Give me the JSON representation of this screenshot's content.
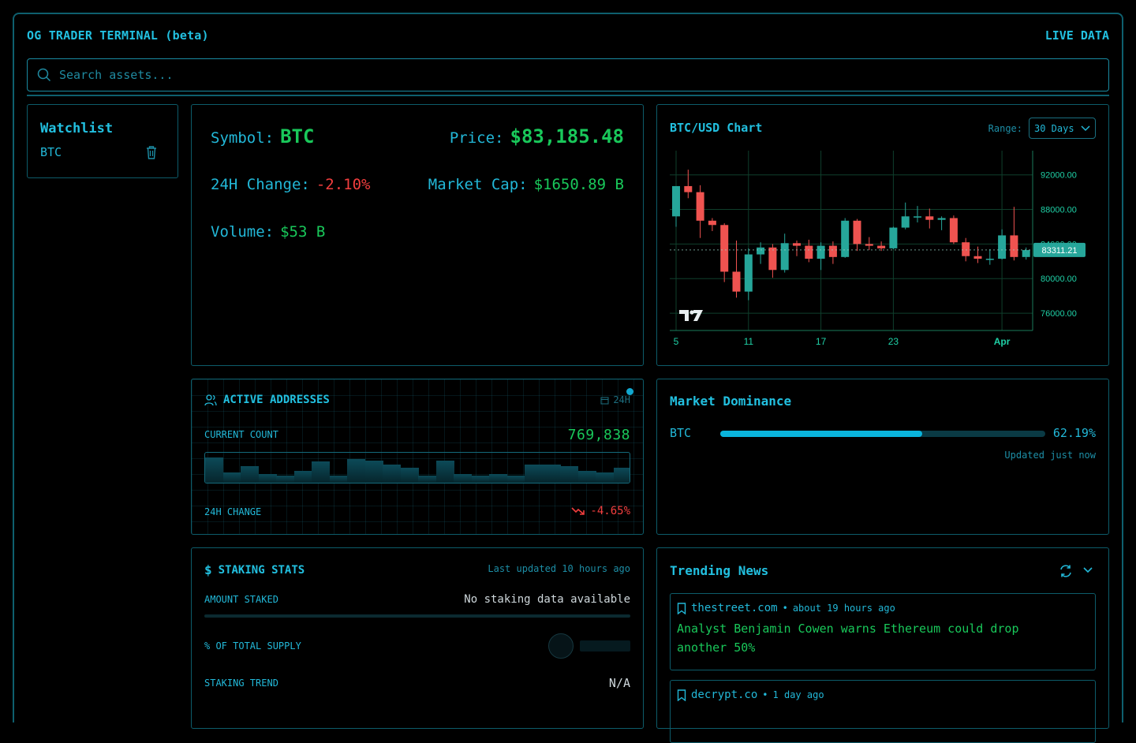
{
  "app": {
    "title": "OG TRADER TERMINAL (beta)",
    "status": "LIVE DATA"
  },
  "search": {
    "placeholder": "Search assets..."
  },
  "watchlist": {
    "title": "Watchlist",
    "items": [
      {
        "symbol": "BTC"
      }
    ]
  },
  "info": {
    "symbol_label": "Symbol:",
    "symbol": "BTC",
    "price_label": "Price:",
    "price": "$83,185.48",
    "change_label": "24H Change:",
    "change": "-2.10%",
    "mcap_label": "Market Cap:",
    "mcap": "$1650.89 B",
    "volume_label": "Volume:",
    "volume": "$53 B"
  },
  "chart": {
    "title": "BTC/USD Chart",
    "range_label": "Range:",
    "range_value": "30 Days",
    "last_price_label": "83311.21"
  },
  "chart_data": {
    "type": "candlestick",
    "title": "BTC/USD Chart",
    "xlabel": "",
    "ylabel": "",
    "ylim": [
      74000,
      94800
    ],
    "y_ticks": [
      "92000.00",
      "88000.00",
      "84000.00",
      "80000.00",
      "76000.00"
    ],
    "x_ticks": [
      {
        "label": "5",
        "index": 0
      },
      {
        "label": "11",
        "index": 6
      },
      {
        "label": "17",
        "index": 12
      },
      {
        "label": "23",
        "index": 18
      },
      {
        "label": "Apr",
        "index": 27
      }
    ],
    "last_price": 83311.21,
    "colors": {
      "up": "#26a69a",
      "down": "#ef5350"
    },
    "candles": [
      {
        "o": 87200,
        "h": 90600,
        "l": 86000,
        "c": 90700
      },
      {
        "o": 90700,
        "h": 92600,
        "l": 89300,
        "c": 90000
      },
      {
        "o": 90000,
        "h": 90800,
        "l": 84700,
        "c": 86700
      },
      {
        "o": 86700,
        "h": 87000,
        "l": 85500,
        "c": 86200
      },
      {
        "o": 86200,
        "h": 86400,
        "l": 79600,
        "c": 80800
      },
      {
        "o": 80800,
        "h": 84400,
        "l": 77800,
        "c": 78500
      },
      {
        "o": 78500,
        "h": 83500,
        "l": 77500,
        "c": 82800
      },
      {
        "o": 82800,
        "h": 84200,
        "l": 81700,
        "c": 83600
      },
      {
        "o": 83600,
        "h": 84000,
        "l": 80100,
        "c": 81000
      },
      {
        "o": 81000,
        "h": 85200,
        "l": 80700,
        "c": 84100
      },
      {
        "o": 84100,
        "h": 84400,
        "l": 82600,
        "c": 83800
      },
      {
        "o": 83800,
        "h": 84500,
        "l": 81900,
        "c": 82300
      },
      {
        "o": 82300,
        "h": 84200,
        "l": 81000,
        "c": 83800
      },
      {
        "o": 83800,
        "h": 84300,
        "l": 81700,
        "c": 82500
      },
      {
        "o": 82500,
        "h": 87000,
        "l": 82400,
        "c": 86700
      },
      {
        "o": 86700,
        "h": 86900,
        "l": 83200,
        "c": 84000
      },
      {
        "o": 84000,
        "h": 84800,
        "l": 83300,
        "c": 83800
      },
      {
        "o": 83800,
        "h": 84300,
        "l": 83200,
        "c": 83500
      },
      {
        "o": 83500,
        "h": 86000,
        "l": 83400,
        "c": 85900
      },
      {
        "o": 85900,
        "h": 88800,
        "l": 85700,
        "c": 87200
      },
      {
        "o": 87200,
        "h": 88400,
        "l": 86500,
        "c": 87200
      },
      {
        "o": 87200,
        "h": 88100,
        "l": 85800,
        "c": 86800
      },
      {
        "o": 86800,
        "h": 87200,
        "l": 85600,
        "c": 87000
      },
      {
        "o": 87000,
        "h": 87300,
        "l": 84000,
        "c": 84200
      },
      {
        "o": 84200,
        "h": 84700,
        "l": 82000,
        "c": 82600
      },
      {
        "o": 82600,
        "h": 83700,
        "l": 81800,
        "c": 82300
      },
      {
        "o": 82300,
        "h": 83400,
        "l": 81600,
        "c": 82300
      },
      {
        "o": 82300,
        "h": 85700,
        "l": 82200,
        "c": 85000
      },
      {
        "o": 85000,
        "h": 88300,
        "l": 82100,
        "c": 82500
      },
      {
        "o": 82500,
        "h": 83600,
        "l": 82200,
        "c": 83300
      }
    ]
  },
  "active": {
    "title": "ACTIVE ADDRESSES",
    "period": "24H",
    "count_label": "CURRENT COUNT",
    "count": "769,838",
    "change_label": "24H CHANGE",
    "change": "-4.65%",
    "spark_levels": [
      0.85,
      0.35,
      0.55,
      0.3,
      0.25,
      0.4,
      0.7,
      0.25,
      0.8,
      0.75,
      0.6,
      0.5,
      0.25,
      0.75,
      0.3,
      0.25,
      0.3,
      0.25,
      0.6,
      0.6,
      0.55,
      0.4,
      0.35,
      0.5
    ]
  },
  "dominance": {
    "title": "Market Dominance",
    "items": [
      {
        "symbol": "BTC",
        "value": "62.19%",
        "fraction": 0.6219
      }
    ],
    "updated": "Updated just now"
  },
  "staking": {
    "title": "STAKING STATS",
    "updated": "Last updated 10 hours ago",
    "amount_label": "AMOUNT STAKED",
    "amount": "No staking data available",
    "supply_label": "% OF TOTAL SUPPLY",
    "trend_label": "STAKING TREND",
    "trend": "N/A"
  },
  "news": {
    "title": "Trending News",
    "items": [
      {
        "source": "thestreet.com",
        "ago": "about 19 hours ago",
        "headline": "Analyst Benjamin Cowen warns Ethereum could drop another 50%"
      },
      {
        "source": "decrypt.co",
        "ago": "1 day ago",
        "headline": ""
      }
    ]
  }
}
